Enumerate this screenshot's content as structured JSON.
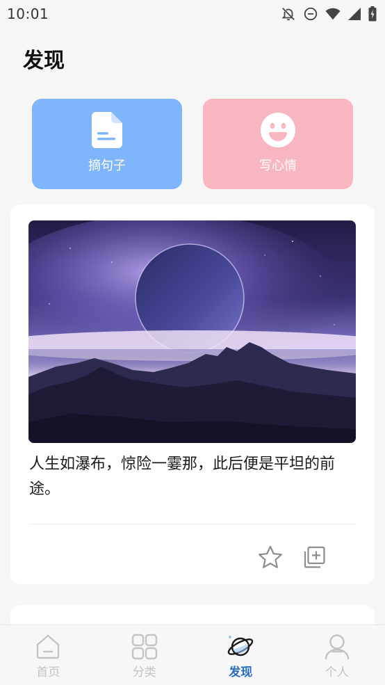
{
  "status_bar": {
    "time": "10:01",
    "icons": [
      "bell-off-icon",
      "do-not-disturb-icon",
      "wifi-icon",
      "signal-icon",
      "battery-icon"
    ]
  },
  "page": {
    "title": "发现"
  },
  "actions": [
    {
      "label": "摘句子",
      "icon": "document-icon",
      "color": "#7fb5fb"
    },
    {
      "label": "写心情",
      "icon": "smiley-icon",
      "color": "#f8b6c1"
    }
  ],
  "card": {
    "text": "人生如瀑布，惊险一霎那，此后便是平坦的前途。",
    "image": "planet-over-mountains",
    "actions": [
      "star-icon",
      "add-to-collection-icon"
    ]
  },
  "nav": {
    "items": [
      {
        "label": "首页",
        "icon": "home-icon",
        "active": false
      },
      {
        "label": "分类",
        "icon": "grid-icon",
        "active": false
      },
      {
        "label": "发现",
        "icon": "planet-icon",
        "active": true
      },
      {
        "label": "个人",
        "icon": "person-icon",
        "active": false
      }
    ],
    "active_color": "#2a6cc4",
    "inactive_color": "#c3c3c3"
  }
}
